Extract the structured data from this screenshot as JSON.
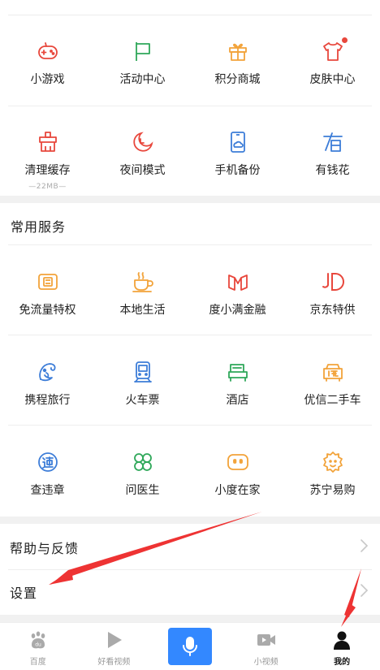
{
  "colors": {
    "red": "#e8473c",
    "green": "#2fa85a",
    "orange": "#f2a33a",
    "blue": "#3d7dd8",
    "accent": "#3388ff",
    "annotation_arrow": "#ee3333"
  },
  "row1": [
    {
      "label": "小游戏",
      "icon": "gamepad-icon"
    },
    {
      "label": "活动中心",
      "icon": "flag-icon"
    },
    {
      "label": "积分商城",
      "icon": "gift-icon"
    },
    {
      "label": "皮肤中心",
      "icon": "tshirt-icon",
      "badge": "red-dot"
    }
  ],
  "row2": [
    {
      "label": "清理缓存",
      "sub": "—22MB—",
      "icon": "broom-icon"
    },
    {
      "label": "夜间模式",
      "icon": "moon-clock-icon"
    },
    {
      "label": "手机备份",
      "icon": "phone-cloud-icon"
    },
    {
      "label": "有钱花",
      "icon": "youqianhua-icon"
    }
  ],
  "common_services": {
    "title": "常用服务",
    "rows": [
      [
        {
          "label": "免流量特权",
          "icon": "sim-card-icon"
        },
        {
          "label": "本地生活",
          "icon": "coffee-cup-icon"
        },
        {
          "label": "度小满金融",
          "icon": "duxiaoman-icon"
        },
        {
          "label": "京东特供",
          "icon": "jd-icon"
        }
      ],
      [
        {
          "label": "携程旅行",
          "icon": "dolphin-icon"
        },
        {
          "label": "火车票",
          "icon": "train-icon"
        },
        {
          "label": "酒店",
          "icon": "bed-icon"
        },
        {
          "label": "优信二手车",
          "icon": "used-car-icon"
        }
      ],
      [
        {
          "label": "查违章",
          "icon": "traffic-violation-icon"
        },
        {
          "label": "问医生",
          "icon": "clover-icon"
        },
        {
          "label": "小度在家",
          "icon": "smart-display-icon"
        },
        {
          "label": "苏宁易购",
          "icon": "suning-lion-icon"
        }
      ]
    ]
  },
  "list": [
    {
      "label": "帮助与反馈"
    },
    {
      "label": "设置"
    }
  ],
  "tabbar": [
    {
      "label": "百度",
      "icon": "baidu-paw-icon"
    },
    {
      "label": "好看视频",
      "icon": "play-icon"
    },
    {
      "label": "",
      "icon": "microphone-icon"
    },
    {
      "label": "小视频",
      "icon": "video-camera-icon"
    },
    {
      "label": "我的",
      "icon": "person-icon",
      "active": true
    }
  ]
}
